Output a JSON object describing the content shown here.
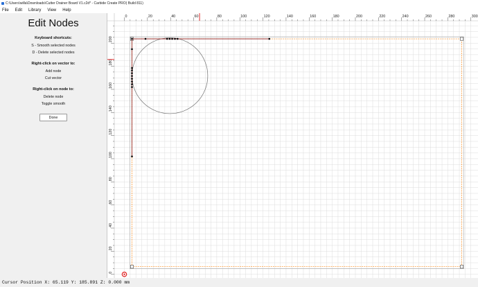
{
  "window": {
    "title": "C:\\Users\\willa\\Downloads\\Cutter Drainer Board V1.c2d* - Carbide Create PRO( Build 811)"
  },
  "menu": {
    "file": "File",
    "edit": "Edit",
    "library": "Library",
    "view": "View",
    "help": "Help"
  },
  "sidebar": {
    "title": "Edit Nodes",
    "shortcuts_heading": "Keyboard shortcuts:",
    "shortcut_smooth": "S - Smooth selected nodes",
    "shortcut_delete": "D - Delete selected nodes",
    "vector_heading": "Right-click on vector to:",
    "add_node": "Add node",
    "cut_vector": "Cut vector",
    "node_heading": "Right-click on node to:",
    "delete_node": "Delete node",
    "toggle_smooth": "Toggle smooth",
    "done_label": "Done"
  },
  "ruler": {
    "x_ticks": [
      "0",
      "20",
      "40",
      "60",
      "80",
      "100",
      "120",
      "140",
      "160",
      "180",
      "200",
      "220",
      "240",
      "260",
      "280",
      "300"
    ],
    "y_ticks": [
      "0",
      "20",
      "40",
      "60",
      "80",
      "100",
      "120",
      "140",
      "160",
      "180",
      "200"
    ],
    "cursor_x_mm": 65.119,
    "cursor_y_mm": 185.891,
    "marker_color": "#e03030"
  },
  "design": {
    "stock_mm": {
      "x0": 6.6,
      "y0": 6.6,
      "x1": 292.1,
      "y1": 203.7
    },
    "circle_mm": {
      "cx": 39.4,
      "cy": 171.8,
      "r": 32.8
    },
    "vector_path_mm": [
      [
        125.5,
        203.7
      ],
      [
        6.6,
        203.7
      ],
      [
        6.6,
        102.0
      ]
    ],
    "nodes_mm": [
      [
        6.6,
        203.7
      ],
      [
        18.3,
        203.7
      ],
      [
        37.0,
        203.7
      ],
      [
        39.2,
        203.7
      ],
      [
        41.4,
        203.7
      ],
      [
        43.8,
        203.7
      ],
      [
        46.1,
        203.7
      ],
      [
        125.5,
        203.7
      ],
      [
        6.6,
        194.8
      ],
      [
        6.6,
        178.5
      ],
      [
        6.6,
        176.4
      ],
      [
        6.6,
        174.0
      ],
      [
        6.6,
        171.6
      ],
      [
        6.6,
        169.2
      ],
      [
        6.6,
        166.8
      ],
      [
        6.6,
        164.4
      ],
      [
        6.6,
        162.0
      ],
      [
        6.6,
        102.0
      ]
    ],
    "stock_color": "#ff8c1a",
    "path_color": "#8b1a1a",
    "circle_color": "#707070",
    "grid_color": "#dcdcdc"
  },
  "status": {
    "text": "Cursor Position X: 65.119 Y: 185.891 Z: 0.000 mm"
  }
}
